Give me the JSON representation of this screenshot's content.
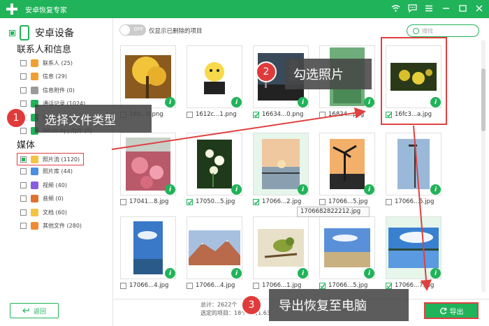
{
  "window": {
    "title": "安卓恢复专家"
  },
  "device": {
    "label": "安卓设备"
  },
  "sections": {
    "contacts": "联系人和信息",
    "media": "媒体"
  },
  "contact_items": [
    {
      "label": "联系人 (25)",
      "icon": "contacts-icon",
      "color": "#f0a030"
    },
    {
      "label": "信息 (29)",
      "icon": "message-icon",
      "color": "#f0a030"
    },
    {
      "label": "信息附件 (0)",
      "icon": "attachment-icon",
      "color": "#9a9a9a"
    },
    {
      "label": "通话记录 (1024)",
      "icon": "call-log-icon",
      "color": "#21b35a"
    },
    {
      "label": "WhatsApp (0)",
      "icon": "whatsapp-icon",
      "color": "#21b35a"
    },
    {
      "label": "WhatsApp附件 (0)",
      "icon": "whatsapp-attachment-icon",
      "color": "#21b35a"
    }
  ],
  "media_items": [
    {
      "label": "照片流 (1120)",
      "icon": "photo-stream-icon",
      "color": "#f5c242"
    },
    {
      "label": "照片库 (44)",
      "icon": "photo-library-icon",
      "color": "#4a8fe0"
    },
    {
      "label": "视频 (40)",
      "icon": "video-icon",
      "color": "#8a5ce0"
    },
    {
      "label": "音频 (0)",
      "icon": "audio-icon",
      "color": "#e07030"
    },
    {
      "label": "文档 (60)",
      "icon": "document-icon",
      "color": "#f5c242"
    },
    {
      "label": "其他文件 (280)",
      "icon": "other-files-icon",
      "color": "#f08a30"
    }
  ],
  "toolbar": {
    "toggle_text": "OFF",
    "show_deleted": "仅显示已删除的项目",
    "search_placeholder": "搜找"
  },
  "grid": [
    {
      "name": "160...0.png",
      "checked": false,
      "img": "yellow-tree"
    },
    {
      "name": "1612c...1.png",
      "checked": false,
      "img": "cartoon"
    },
    {
      "name": "16634...0.png",
      "checked": true,
      "img": "street"
    },
    {
      "name": "16824...png",
      "checked": false,
      "img": "green"
    },
    {
      "name": "16fc3...a.jpg",
      "checked": true,
      "img": "yellow-flowers"
    },
    {
      "name": "17041...8.jpg",
      "checked": false,
      "img": "pink-flowers"
    },
    {
      "name": "17050...5.jpg",
      "checked": true,
      "img": "white-flowers"
    },
    {
      "name": "17066...2.jpg",
      "checked": true,
      "img": "sunset-pier"
    },
    {
      "name": "17066...5.jpg",
      "checked": false,
      "img": "palm-sunset"
    },
    {
      "name": "17066...5.jpg",
      "checked": false,
      "img": "streetlight"
    },
    {
      "name": "17066...4.jpg",
      "checked": false,
      "img": "blue-sky"
    },
    {
      "name": "17066...4.jpg",
      "checked": false,
      "img": "mountain"
    },
    {
      "name": "17066...1.jpg",
      "checked": false,
      "img": "bird"
    },
    {
      "name": "17066...5.jpg",
      "checked": true,
      "img": "meadow"
    },
    {
      "name": "17066...7.jpg",
      "checked": true,
      "img": "lake"
    }
  ],
  "tooltip": "1706682822212.jpg",
  "footer": {
    "total": "总计：2622个",
    "selected": "选定的项目：18个项目1.63",
    "back_label": "返回",
    "export_label": "导出"
  },
  "annotations": {
    "step1_num": "1",
    "step1_text": "选择文件类型",
    "step2_num": "2",
    "step2_text": "勾选照片",
    "step3_num": "3",
    "step3_text": "导出恢复至电脑"
  },
  "colors": {
    "accent": "#21b35a",
    "annotation": "#e04040"
  }
}
